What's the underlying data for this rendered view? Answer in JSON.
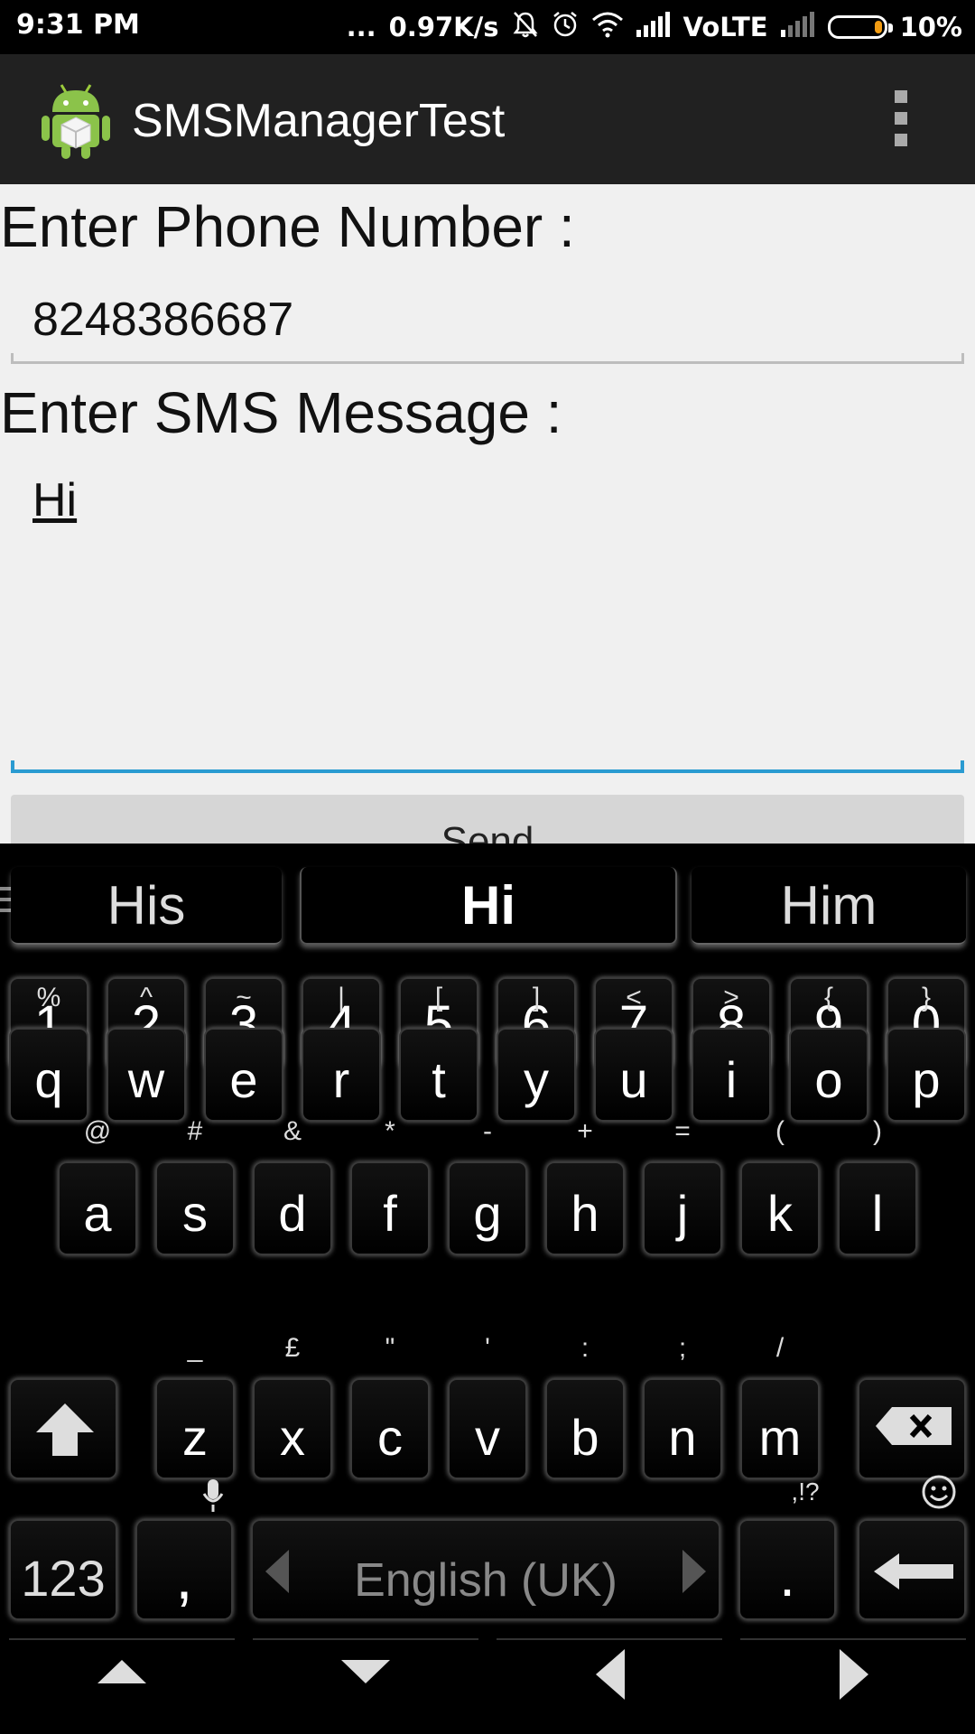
{
  "status_bar": {
    "time": "9:31 PM",
    "dots": "...",
    "speed": "0.97K/s",
    "network": "VoLTE",
    "battery": "10%",
    "icons": [
      "mute-icon",
      "alarm-icon",
      "wifi-icon",
      "signal-icon",
      "signal-weak-icon",
      "battery-icon"
    ]
  },
  "app_bar": {
    "title": "SMSManagerTest",
    "icon": "android-icon",
    "menu_icon": "overflow-menu-icon"
  },
  "form": {
    "phone_label": "Enter Phone Number :",
    "phone_value": "8248386687",
    "message_label": "Enter SMS Message :",
    "message_value": "Hi",
    "send_label": "Send"
  },
  "keyboard": {
    "suggestions": [
      "His",
      "Hi",
      "Him"
    ],
    "number_row": [
      "1",
      "2",
      "3",
      "4",
      "5",
      "6",
      "7",
      "8",
      "9",
      "0"
    ],
    "row1": [
      {
        "key": "q",
        "alt": "%"
      },
      {
        "key": "w",
        "alt": "^"
      },
      {
        "key": "e",
        "alt": "~"
      },
      {
        "key": "r",
        "alt": "|"
      },
      {
        "key": "t",
        "alt": "["
      },
      {
        "key": "y",
        "alt": "]"
      },
      {
        "key": "u",
        "alt": "<"
      },
      {
        "key": "i",
        "alt": ">"
      },
      {
        "key": "o",
        "alt": "{"
      },
      {
        "key": "p",
        "alt": "}"
      }
    ],
    "row2": [
      {
        "key": "a",
        "alt": "@"
      },
      {
        "key": "s",
        "alt": "#"
      },
      {
        "key": "d",
        "alt": "&"
      },
      {
        "key": "f",
        "alt": "*"
      },
      {
        "key": "g",
        "alt": "-"
      },
      {
        "key": "h",
        "alt": "+"
      },
      {
        "key": "j",
        "alt": "="
      },
      {
        "key": "k",
        "alt": "("
      },
      {
        "key": "l",
        "alt": ")"
      }
    ],
    "row3": [
      {
        "key": "z",
        "alt": "_"
      },
      {
        "key": "x",
        "alt": "£"
      },
      {
        "key": "c",
        "alt": "\""
      },
      {
        "key": "v",
        "alt": "'"
      },
      {
        "key": "b",
        "alt": ":"
      },
      {
        "key": "n",
        "alt": ";"
      },
      {
        "key": "m",
        "alt": "/"
      }
    ],
    "symbols_key": "123",
    "comma_key": ",",
    "space_label": "English (UK)",
    "period_key": ".",
    "period_alt": ",!?",
    "icons": {
      "shift": "shift-icon",
      "backspace": "backspace-icon",
      "mic": "mic-icon",
      "emoji": "emoji-icon",
      "enter": "enter-icon"
    }
  }
}
